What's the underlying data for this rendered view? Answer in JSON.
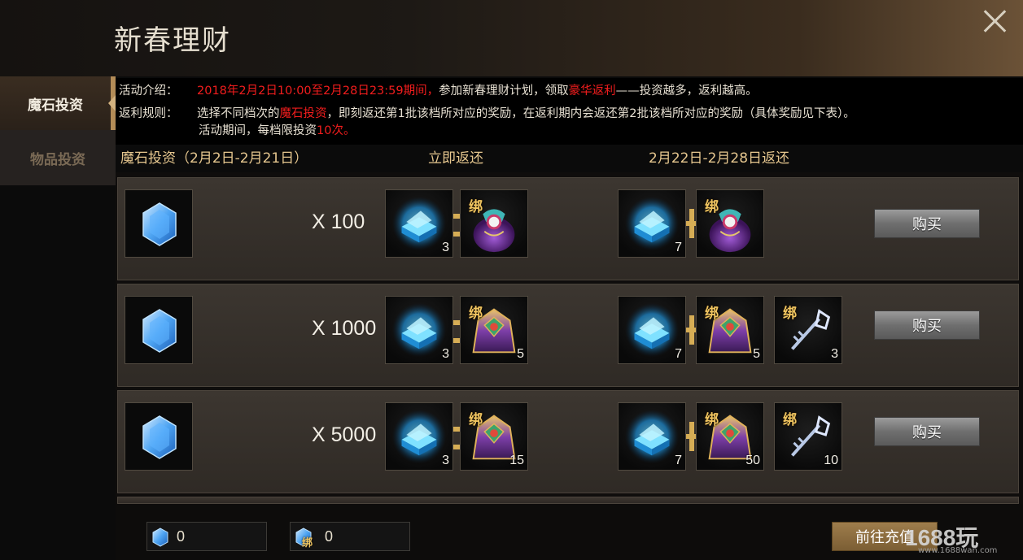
{
  "window": {
    "title": "新春理财",
    "close_icon": "close-icon"
  },
  "sidebar": {
    "tabs": [
      {
        "label": "魔石投资",
        "active": true
      },
      {
        "label": "物品投资",
        "active": false
      }
    ]
  },
  "info": {
    "intro_label": "活动介绍：",
    "intro_period": "2018年2月2日10:00至2月28日23:59期间，",
    "intro_text1": "参加新春理财计划，领取",
    "intro_highlight": "豪华返利",
    "intro_text2": "——投资越多，返利越高。",
    "rules_label": "返利规则：",
    "rules_text1": "选择不同档次的",
    "rules_highlight": "魔石投资",
    "rules_text2": "，即刻返还第1批该档所对应的奖励，在返利期内会返还第2批该档所对应的奖励（具体奖励见下表）。",
    "rules_line2_text": "活动期间，每档限投资",
    "rules_line2_highlight": "10次。"
  },
  "columns": {
    "investment": "魔石投资（2月2日-2月21日）",
    "immediate": "立即返还",
    "later": "2月22日-2月28日返还"
  },
  "tiers": [
    {
      "amount": "X 100",
      "immediate": [
        {
          "item": "crystal-chest",
          "count": "3",
          "bound": false
        },
        {
          "item": "purple-bag",
          "count": "",
          "bound": true,
          "bind_label": "绑"
        }
      ],
      "later": [
        {
          "item": "crystal-chest",
          "count": "7",
          "bound": false
        },
        {
          "item": "purple-bag",
          "count": "",
          "bound": true,
          "bind_label": "绑"
        }
      ],
      "buy_label": "购买"
    },
    {
      "amount": "X 1000",
      "immediate": [
        {
          "item": "crystal-chest",
          "count": "3",
          "bound": false
        },
        {
          "item": "golden-pack",
          "count": "5",
          "bound": true,
          "bind_label": "绑"
        }
      ],
      "later": [
        {
          "item": "crystal-chest",
          "count": "7",
          "bound": false
        },
        {
          "item": "golden-pack",
          "count": "5",
          "bound": true,
          "bind_label": "绑"
        },
        {
          "item": "ice-key",
          "count": "3",
          "bound": true,
          "bind_label": "绑"
        }
      ],
      "buy_label": "购买"
    },
    {
      "amount": "X 5000",
      "immediate": [
        {
          "item": "crystal-chest",
          "count": "3",
          "bound": false
        },
        {
          "item": "golden-pack",
          "count": "15",
          "bound": true,
          "bind_label": "绑"
        }
      ],
      "later": [
        {
          "item": "crystal-chest",
          "count": "7",
          "bound": false
        },
        {
          "item": "golden-pack",
          "count": "50",
          "bound": true,
          "bind_label": "绑"
        },
        {
          "item": "ice-key",
          "count": "10",
          "bound": true,
          "bind_label": "绑"
        }
      ],
      "buy_label": "购买"
    }
  ],
  "footer": {
    "gem_balance": "0",
    "bound_gem_balance": "0",
    "bound_label": "绑",
    "recharge_label": "前往充值",
    "watermark": "1688玩",
    "watermark_url": "www.1688wan.com"
  },
  "colors": {
    "accent_gold": "#d6ad55",
    "highlight_red": "#f21d1d",
    "header_text": "#e6c78f"
  }
}
